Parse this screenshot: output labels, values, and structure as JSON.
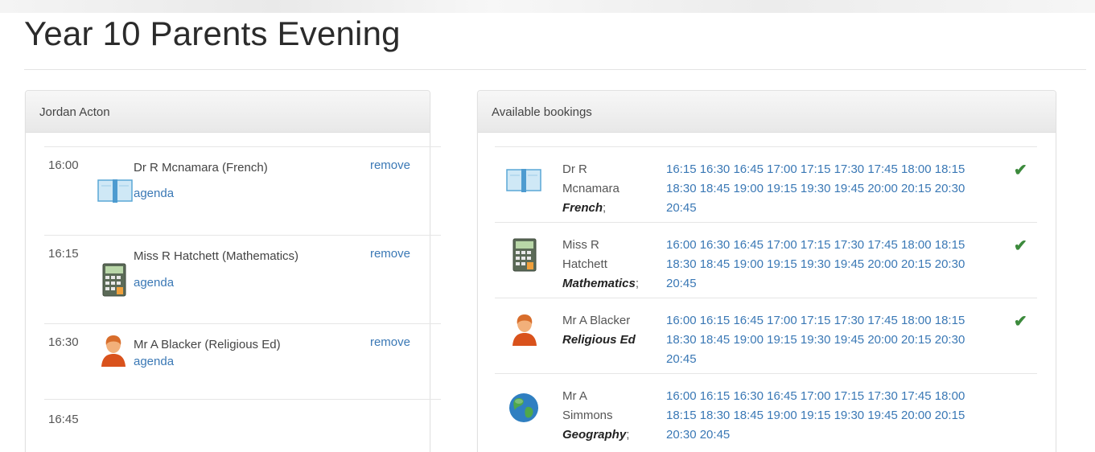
{
  "page": {
    "title": "Year 10 Parents Evening"
  },
  "student_panel": {
    "heading": "Jordan Acton",
    "appointments": [
      {
        "time": "16:00",
        "teacher": "Dr R Mcnamara (French)",
        "agenda": "agenda",
        "remove": "remove",
        "icon": "book-icon"
      },
      {
        "time": "16:15",
        "teacher": "Miss R Hatchett (Mathematics)",
        "agenda": "agenda",
        "remove": "remove",
        "icon": "calculator-icon"
      },
      {
        "time": "16:30",
        "teacher": "Mr A Blacker (Religious Ed)",
        "agenda": "agenda",
        "remove": "remove",
        "icon": "person-icon"
      },
      {
        "time": "16:45"
      }
    ]
  },
  "bookings_panel": {
    "heading": "Available bookings",
    "rows": [
      {
        "name_line1": "Dr R",
        "name_line2": "Mcnamara",
        "subject": "French",
        "sep": ";",
        "slots": [
          "16:15",
          "16:30",
          "16:45",
          "17:00",
          "17:15",
          "17:30",
          "17:45",
          "18:00",
          "18:15",
          "18:30",
          "18:45",
          "19:00",
          "19:15",
          "19:30",
          "19:45",
          "20:00",
          "20:15",
          "20:30",
          "20:45"
        ],
        "booked": "✔",
        "icon": "book-icon"
      },
      {
        "name_line1": "Miss R",
        "name_line2": "Hatchett",
        "subject": "Mathematics",
        "sep": ";",
        "slots": [
          "16:00",
          "16:30",
          "16:45",
          "17:00",
          "17:15",
          "17:30",
          "17:45",
          "18:00",
          "18:15",
          "18:30",
          "18:45",
          "19:00",
          "19:15",
          "19:30",
          "19:45",
          "20:00",
          "20:15",
          "20:30",
          "20:45"
        ],
        "booked": "✔",
        "icon": "calculator-icon"
      },
      {
        "name_line1": "Mr A Blacker",
        "subject": "Religious Ed",
        "slots": [
          "16:00",
          "16:15",
          "16:45",
          "17:00",
          "17:15",
          "17:30",
          "17:45",
          "18:00",
          "18:15",
          "18:30",
          "18:45",
          "19:00",
          "19:15",
          "19:30",
          "19:45",
          "20:00",
          "20:15",
          "20:30",
          "20:45"
        ],
        "booked": "✔",
        "icon": "person-icon"
      },
      {
        "name_line1": "Mr A",
        "name_line2": "Simmons",
        "subject": "Geography",
        "sep": ";",
        "slots": [
          "16:00",
          "16:15",
          "16:30",
          "16:45",
          "17:00",
          "17:15",
          "17:30",
          "17:45",
          "18:00",
          "18:15",
          "18:30",
          "18:45",
          "19:00",
          "19:15",
          "19:30",
          "19:45",
          "20:00",
          "20:15",
          "20:30",
          "20:45"
        ],
        "icon": "globe-icon"
      }
    ]
  },
  "colors": {
    "link": "#3a78b5",
    "check": "#3c8a3c"
  }
}
